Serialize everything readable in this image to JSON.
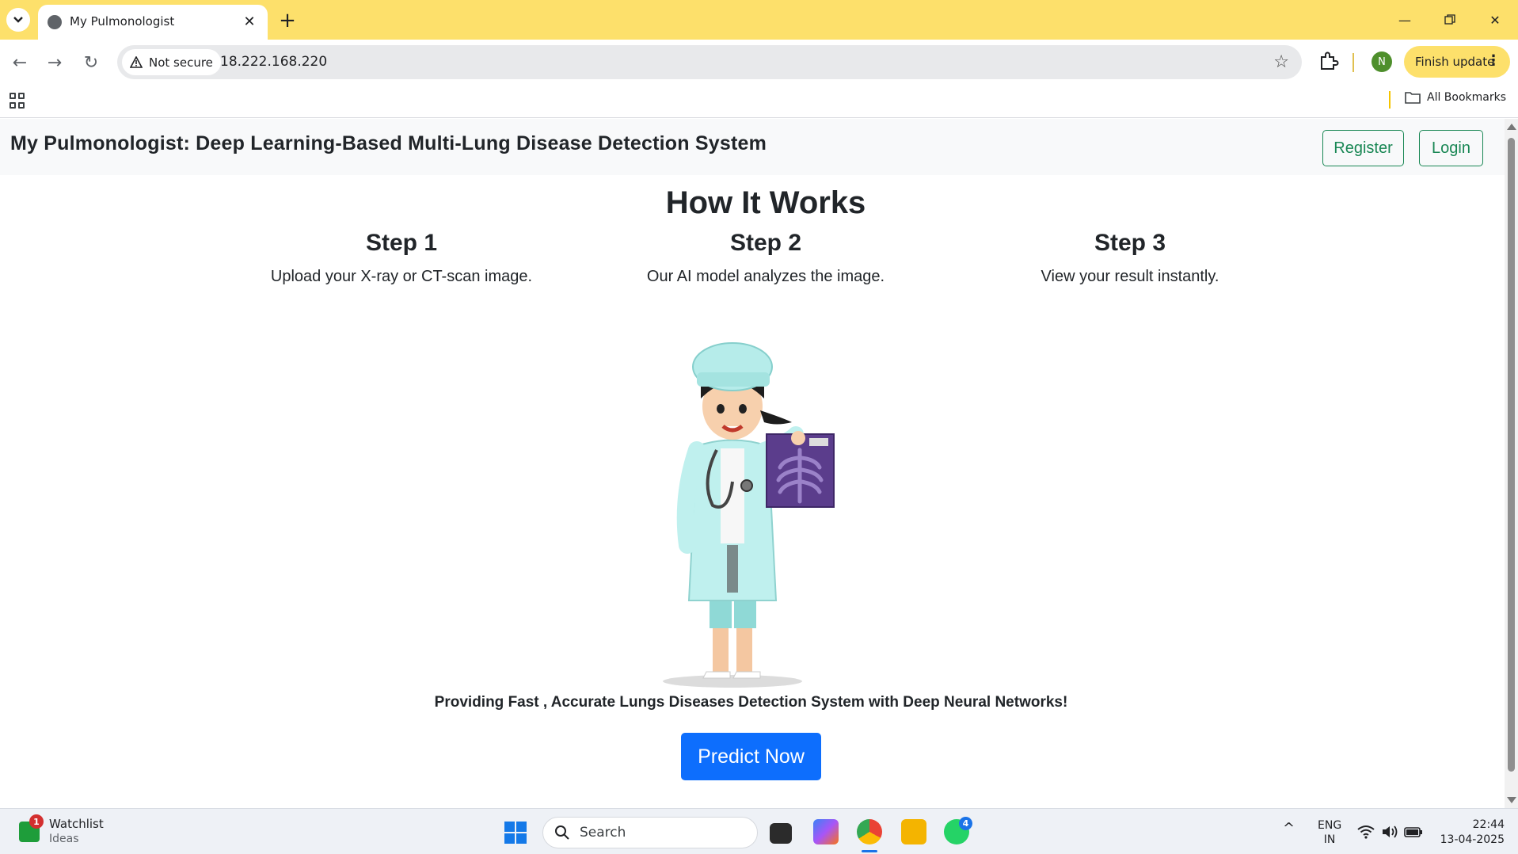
{
  "browser": {
    "tab_title": "My Pulmonologist",
    "security_label": "Not secure",
    "url": "18.222.168.220",
    "finish_update_label": "Finish update",
    "profile_initial": "N",
    "all_bookmarks_label": "All Bookmarks"
  },
  "site": {
    "brand": "My Pulmonologist: Deep Learning-Based Multi-Lung Disease Detection System",
    "nav": {
      "register_label": "Register",
      "login_label": "Login"
    },
    "hero_title": "How It Works",
    "steps": [
      {
        "title": "Step 1",
        "description": "Upload your X-ray or CT-scan image."
      },
      {
        "title": "Step 2",
        "description": "Our AI model analyzes the image."
      },
      {
        "title": "Step 3",
        "description": "View your result instantly."
      }
    ],
    "tagline": "Providing Fast , Accurate Lungs Diseases Detection System with Deep Neural Networks!",
    "predict_button_label": "Predict Now",
    "colors": {
      "navbar_bg": "#f8f9fa",
      "outline_green": "#198754",
      "primary_blue": "#0d6efd"
    }
  },
  "taskbar": {
    "watchlist_title": "Watchlist",
    "watchlist_subtitle": "Ideas",
    "watchlist_badge": "1",
    "search_placeholder": "Search",
    "whatsapp_badge": "4",
    "lang_primary": "ENG",
    "lang_secondary": "IN",
    "time": "22:44",
    "date": "13-04-2025"
  }
}
